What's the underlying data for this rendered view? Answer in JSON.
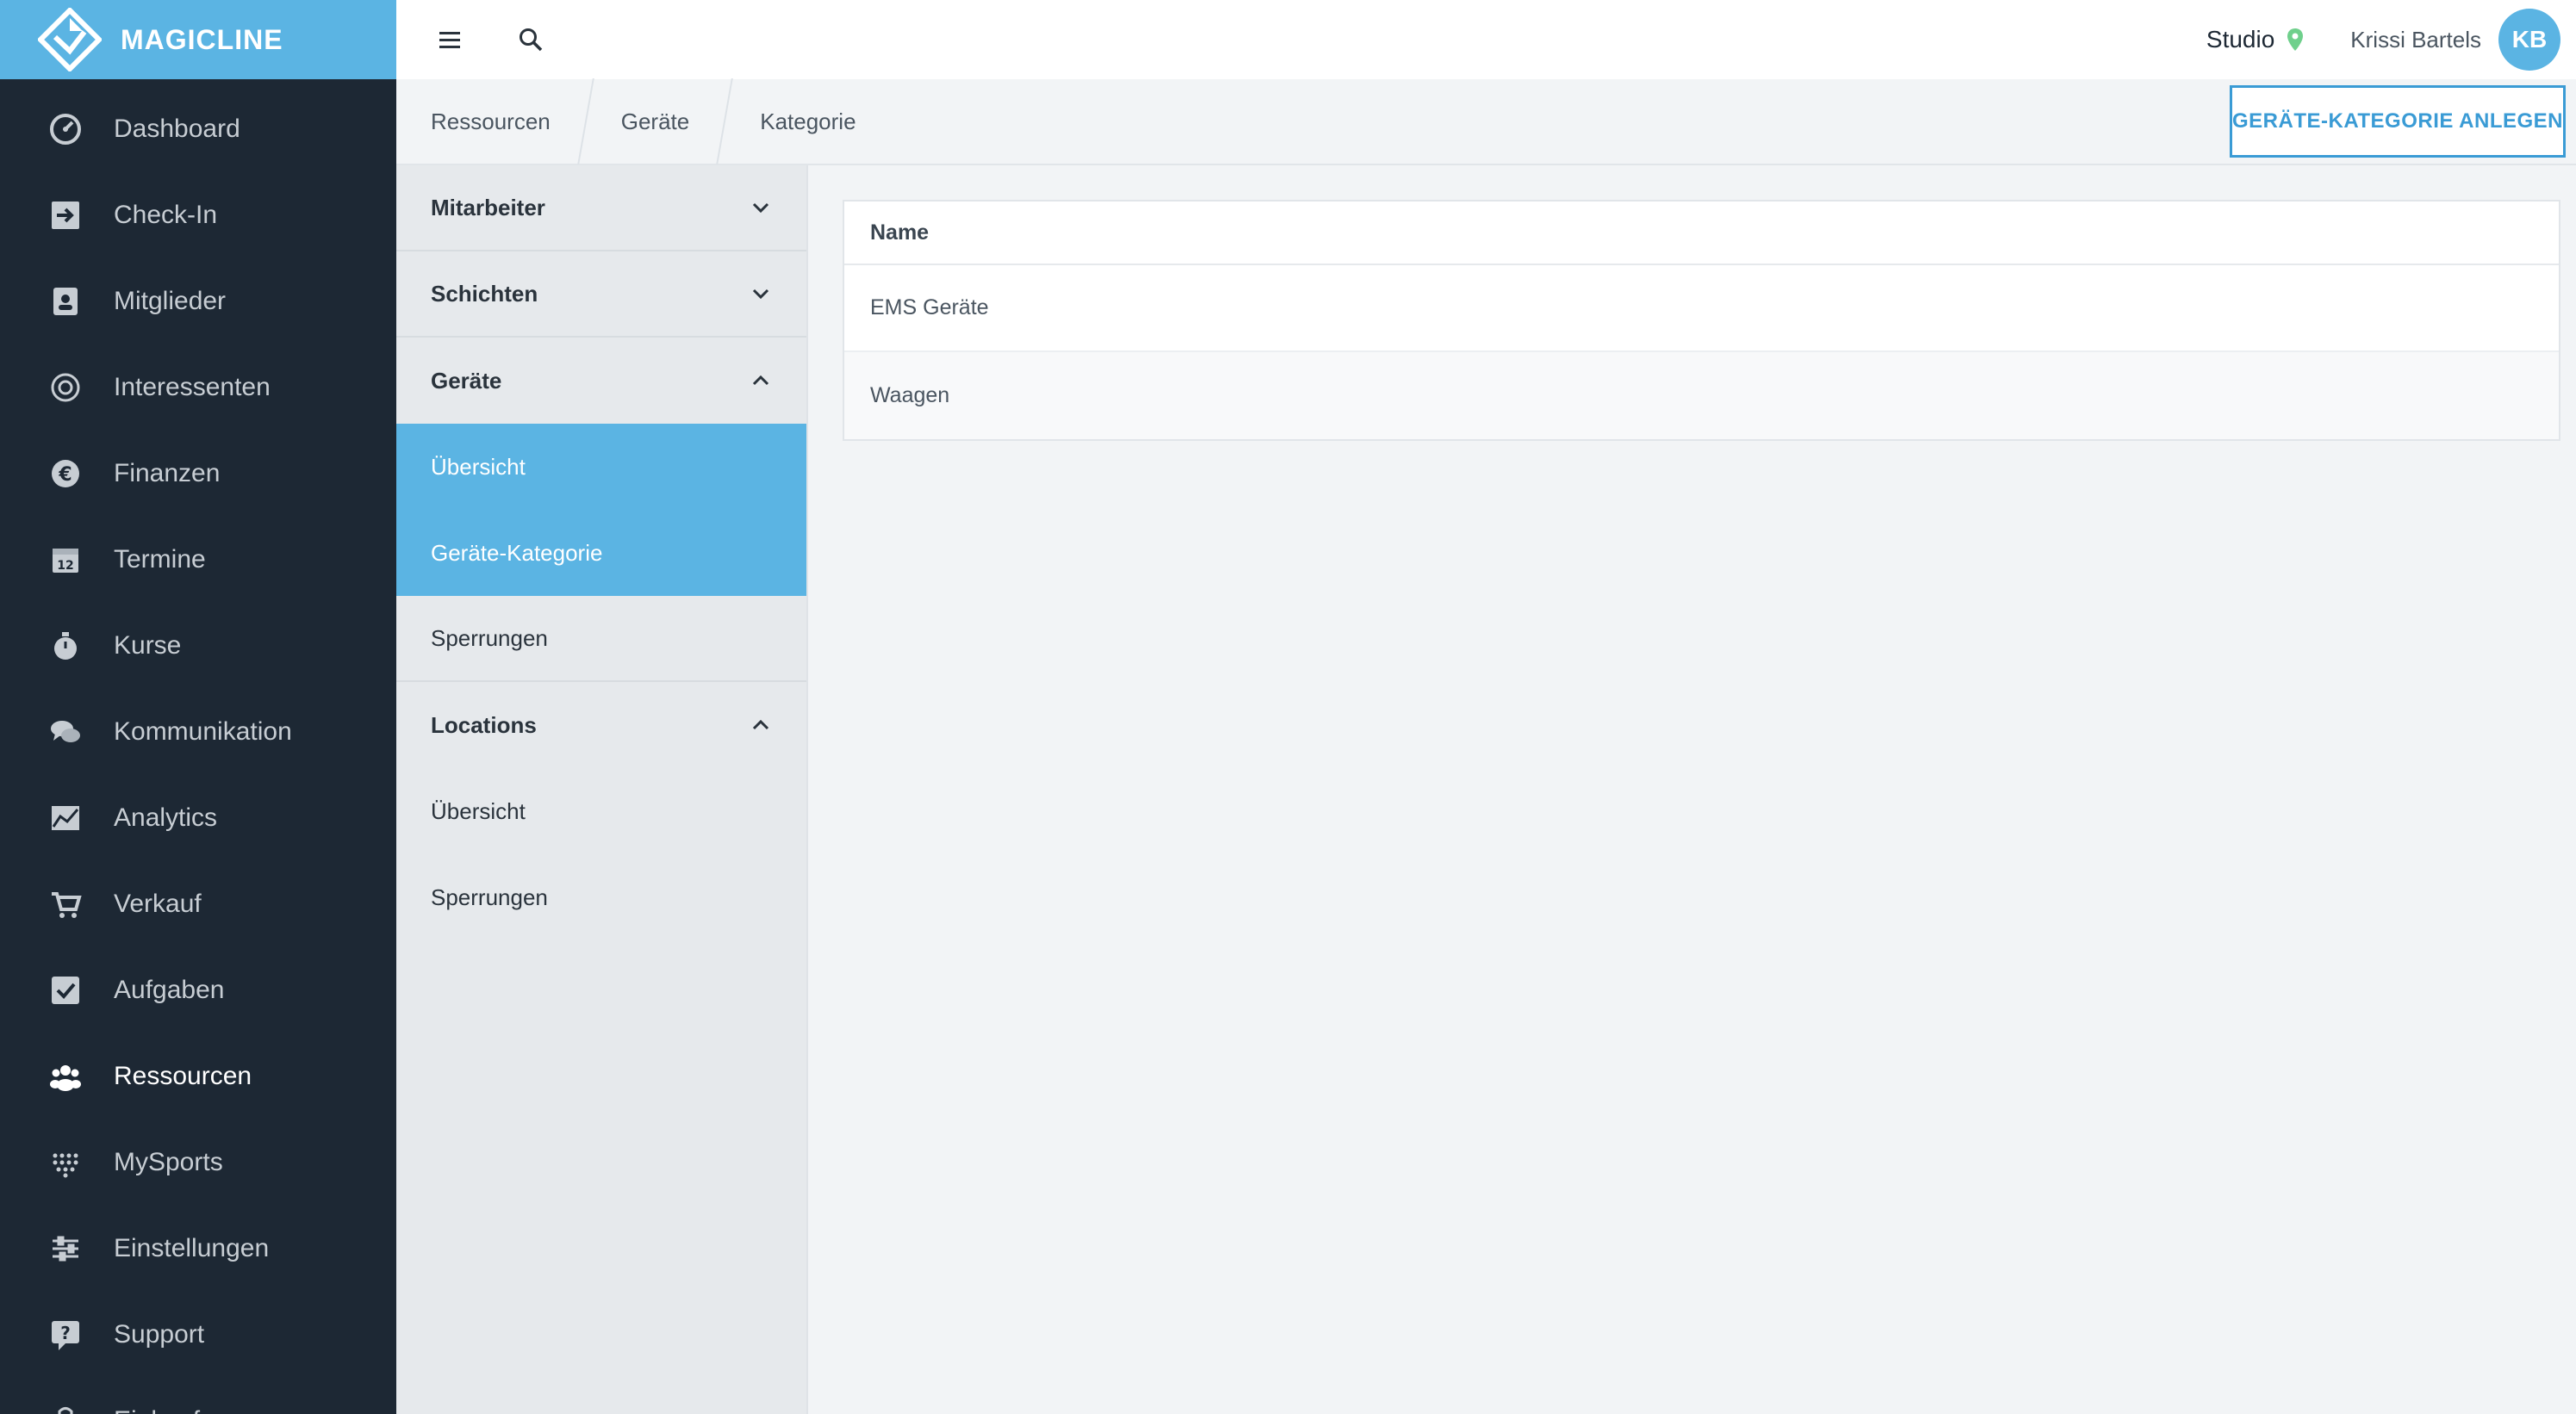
{
  "brand": {
    "name": "MAGICLINE"
  },
  "nav": {
    "items": [
      {
        "label": "Dashboard",
        "icon": "dashboard-icon",
        "active": false
      },
      {
        "label": "Check-In",
        "icon": "check-in-icon",
        "active": false
      },
      {
        "label": "Mitglieder",
        "icon": "members-icon",
        "active": false
      },
      {
        "label": "Interessenten",
        "icon": "target-icon",
        "active": false
      },
      {
        "label": "Finanzen",
        "icon": "euro-icon",
        "active": false
      },
      {
        "label": "Termine",
        "icon": "calendar-icon",
        "active": false
      },
      {
        "label": "Kurse",
        "icon": "stopwatch-icon",
        "active": false
      },
      {
        "label": "Kommunikation",
        "icon": "chat-icon",
        "active": false
      },
      {
        "label": "Analytics",
        "icon": "chart-icon",
        "active": false
      },
      {
        "label": "Verkauf",
        "icon": "cart-icon",
        "active": false
      },
      {
        "label": "Aufgaben",
        "icon": "checkbox-icon",
        "active": false
      },
      {
        "label": "Ressourcen",
        "icon": "people-icon",
        "active": true
      },
      {
        "label": "MySports",
        "icon": "dots-grid-icon",
        "active": false
      },
      {
        "label": "Einstellungen",
        "icon": "sliders-icon",
        "active": false
      },
      {
        "label": "Support",
        "icon": "help-icon",
        "active": false
      },
      {
        "label": "Einkaufen",
        "icon": "shop-icon",
        "active": false
      }
    ]
  },
  "topbar": {
    "studio_label": "Studio",
    "user_name": "Krissi Bartels",
    "avatar_initials": "KB"
  },
  "breadcrumb": {
    "items": [
      "Ressourcen",
      "Geräte",
      "Kategorie"
    ]
  },
  "actions": {
    "create_label": "GERÄTE-KATEGORIE ANLEGEN"
  },
  "submenu": {
    "mitarbeiter": "Mitarbeiter",
    "schichten": "Schichten",
    "geraete": "Geräte",
    "geraete_uebersicht": "Übersicht",
    "geraete_kategorie": "Geräte-Kategorie",
    "geraete_sperrungen": "Sperrungen",
    "locations": "Locations",
    "locations_uebersicht": "Übersicht",
    "locations_sperrungen": "Sperrungen"
  },
  "table": {
    "header": "Name",
    "rows": [
      "EMS Geräte",
      "Waagen"
    ]
  },
  "colors": {
    "accent": "#5bb4e3",
    "sidebar_bg": "#1d2834",
    "button_border": "#3a9bd5",
    "location_pin": "#6fd08c"
  }
}
